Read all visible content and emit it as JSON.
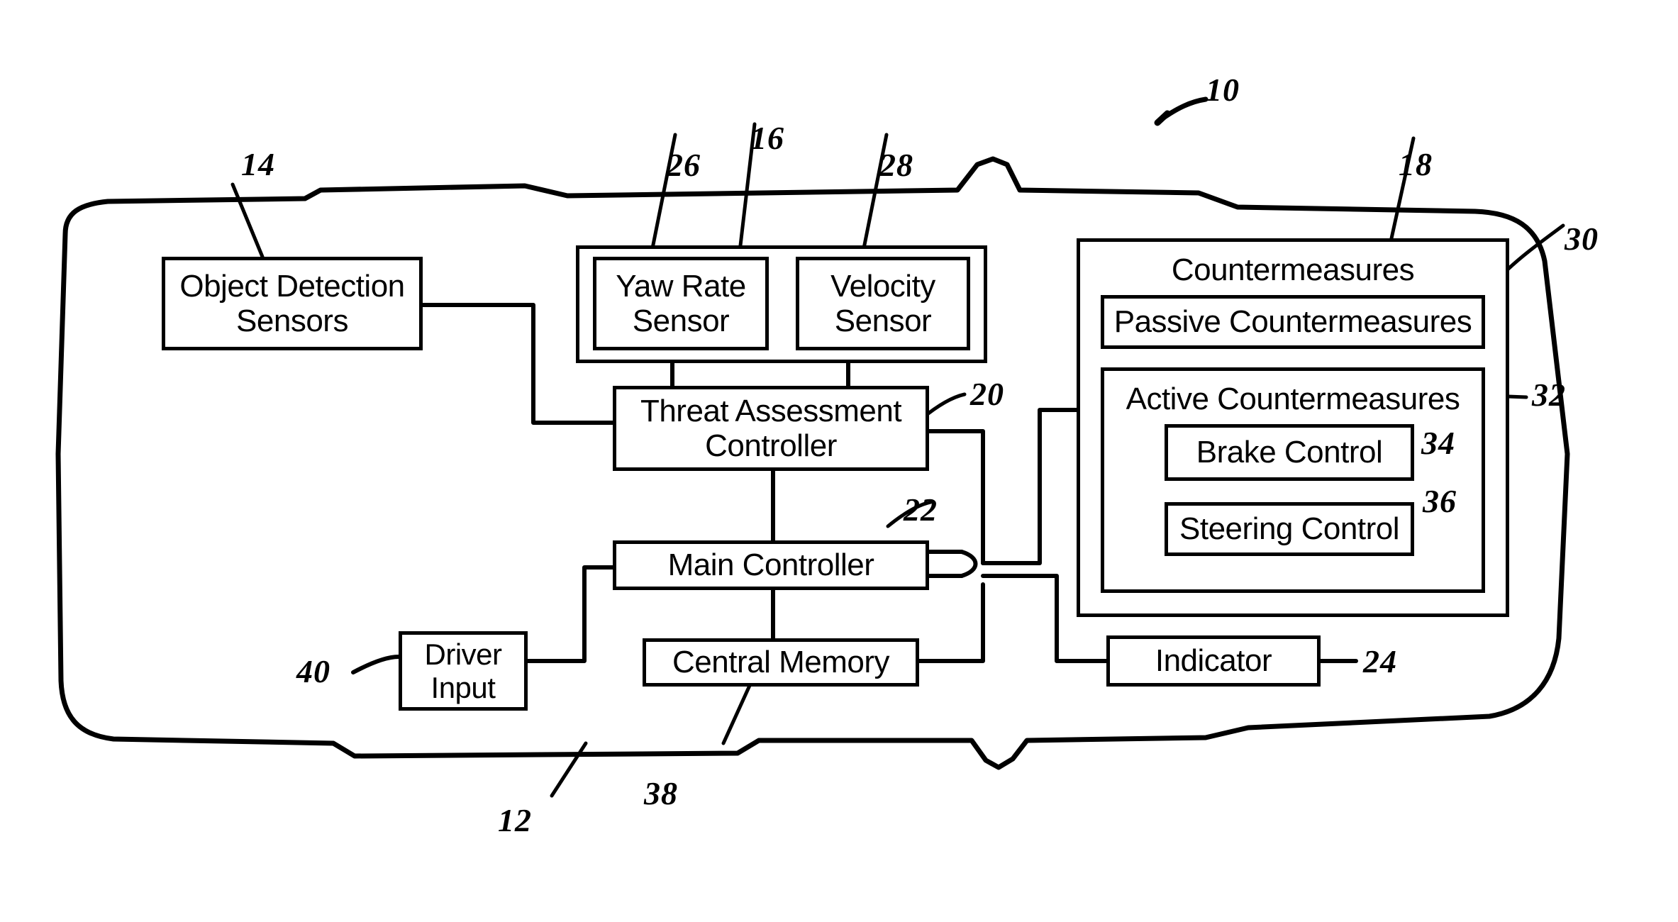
{
  "figure": {
    "type": "patent-block-diagram",
    "description": "Vehicle collision threat assessment and countermeasure system block diagram"
  },
  "blocks": {
    "object_detection_sensors": "Object Detection\nSensors",
    "object_detection_line1": "Object Detection",
    "object_detection_line2": "Sensors",
    "yaw_rate_line1": "Yaw Rate",
    "yaw_rate_line2": "Sensor",
    "velocity_line1": "Velocity",
    "velocity_line2": "Sensor",
    "threat_assessment_line1": "Threat Assessment",
    "threat_assessment_line2": "Controller",
    "main_controller": "Main Controller",
    "central_memory": "Central Memory",
    "driver_input_line1": "Driver",
    "driver_input_line2": "Input",
    "indicator": "Indicator",
    "countermeasures_title": "Countermeasures",
    "passive_countermeasures": "Passive Countermeasures",
    "active_countermeasures_title": "Active Countermeasures",
    "brake_control": "Brake Control",
    "steering_control": "Steering Control"
  },
  "reference_numerals": {
    "n10": "10",
    "n12": "12",
    "n14": "14",
    "n16": "16",
    "n18": "18",
    "n20": "20",
    "n22": "22",
    "n24": "24",
    "n26": "26",
    "n28": "28",
    "n30": "30",
    "n32": "32",
    "n34": "34",
    "n36": "36",
    "n38": "38",
    "n40": "40"
  },
  "colors": {
    "stroke": "#000000",
    "background": "#ffffff"
  }
}
